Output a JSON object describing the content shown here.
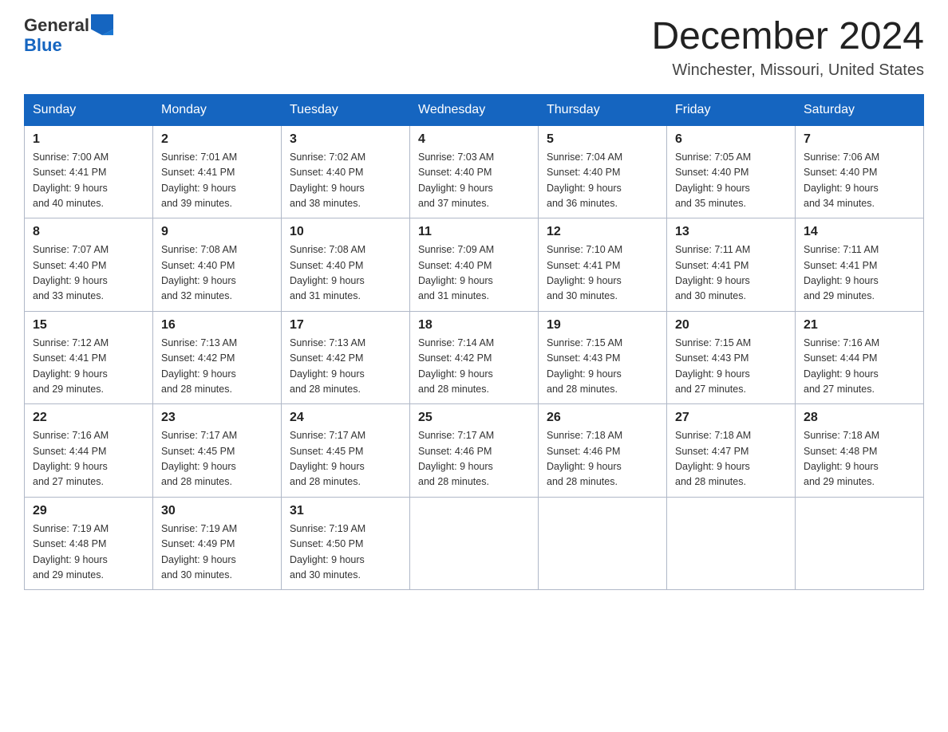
{
  "header": {
    "logo_text_general": "General",
    "logo_text_blue": "Blue",
    "month_year": "December 2024",
    "location": "Winchester, Missouri, United States"
  },
  "weekdays": [
    "Sunday",
    "Monday",
    "Tuesday",
    "Wednesday",
    "Thursday",
    "Friday",
    "Saturday"
  ],
  "weeks": [
    [
      {
        "day": "1",
        "sunrise": "7:00 AM",
        "sunset": "4:41 PM",
        "daylight": "9 hours and 40 minutes."
      },
      {
        "day": "2",
        "sunrise": "7:01 AM",
        "sunset": "4:41 PM",
        "daylight": "9 hours and 39 minutes."
      },
      {
        "day": "3",
        "sunrise": "7:02 AM",
        "sunset": "4:40 PM",
        "daylight": "9 hours and 38 minutes."
      },
      {
        "day": "4",
        "sunrise": "7:03 AM",
        "sunset": "4:40 PM",
        "daylight": "9 hours and 37 minutes."
      },
      {
        "day": "5",
        "sunrise": "7:04 AM",
        "sunset": "4:40 PM",
        "daylight": "9 hours and 36 minutes."
      },
      {
        "day": "6",
        "sunrise": "7:05 AM",
        "sunset": "4:40 PM",
        "daylight": "9 hours and 35 minutes."
      },
      {
        "day": "7",
        "sunrise": "7:06 AM",
        "sunset": "4:40 PM",
        "daylight": "9 hours and 34 minutes."
      }
    ],
    [
      {
        "day": "8",
        "sunrise": "7:07 AM",
        "sunset": "4:40 PM",
        "daylight": "9 hours and 33 minutes."
      },
      {
        "day": "9",
        "sunrise": "7:08 AM",
        "sunset": "4:40 PM",
        "daylight": "9 hours and 32 minutes."
      },
      {
        "day": "10",
        "sunrise": "7:08 AM",
        "sunset": "4:40 PM",
        "daylight": "9 hours and 31 minutes."
      },
      {
        "day": "11",
        "sunrise": "7:09 AM",
        "sunset": "4:40 PM",
        "daylight": "9 hours and 31 minutes."
      },
      {
        "day": "12",
        "sunrise": "7:10 AM",
        "sunset": "4:41 PM",
        "daylight": "9 hours and 30 minutes."
      },
      {
        "day": "13",
        "sunrise": "7:11 AM",
        "sunset": "4:41 PM",
        "daylight": "9 hours and 30 minutes."
      },
      {
        "day": "14",
        "sunrise": "7:11 AM",
        "sunset": "4:41 PM",
        "daylight": "9 hours and 29 minutes."
      }
    ],
    [
      {
        "day": "15",
        "sunrise": "7:12 AM",
        "sunset": "4:41 PM",
        "daylight": "9 hours and 29 minutes."
      },
      {
        "day": "16",
        "sunrise": "7:13 AM",
        "sunset": "4:42 PM",
        "daylight": "9 hours and 28 minutes."
      },
      {
        "day": "17",
        "sunrise": "7:13 AM",
        "sunset": "4:42 PM",
        "daylight": "9 hours and 28 minutes."
      },
      {
        "day": "18",
        "sunrise": "7:14 AM",
        "sunset": "4:42 PM",
        "daylight": "9 hours and 28 minutes."
      },
      {
        "day": "19",
        "sunrise": "7:15 AM",
        "sunset": "4:43 PM",
        "daylight": "9 hours and 28 minutes."
      },
      {
        "day": "20",
        "sunrise": "7:15 AM",
        "sunset": "4:43 PM",
        "daylight": "9 hours and 27 minutes."
      },
      {
        "day": "21",
        "sunrise": "7:16 AM",
        "sunset": "4:44 PM",
        "daylight": "9 hours and 27 minutes."
      }
    ],
    [
      {
        "day": "22",
        "sunrise": "7:16 AM",
        "sunset": "4:44 PM",
        "daylight": "9 hours and 27 minutes."
      },
      {
        "day": "23",
        "sunrise": "7:17 AM",
        "sunset": "4:45 PM",
        "daylight": "9 hours and 28 minutes."
      },
      {
        "day": "24",
        "sunrise": "7:17 AM",
        "sunset": "4:45 PM",
        "daylight": "9 hours and 28 minutes."
      },
      {
        "day": "25",
        "sunrise": "7:17 AM",
        "sunset": "4:46 PM",
        "daylight": "9 hours and 28 minutes."
      },
      {
        "day": "26",
        "sunrise": "7:18 AM",
        "sunset": "4:46 PM",
        "daylight": "9 hours and 28 minutes."
      },
      {
        "day": "27",
        "sunrise": "7:18 AM",
        "sunset": "4:47 PM",
        "daylight": "9 hours and 28 minutes."
      },
      {
        "day": "28",
        "sunrise": "7:18 AM",
        "sunset": "4:48 PM",
        "daylight": "9 hours and 29 minutes."
      }
    ],
    [
      {
        "day": "29",
        "sunrise": "7:19 AM",
        "sunset": "4:48 PM",
        "daylight": "9 hours and 29 minutes."
      },
      {
        "day": "30",
        "sunrise": "7:19 AM",
        "sunset": "4:49 PM",
        "daylight": "9 hours and 30 minutes."
      },
      {
        "day": "31",
        "sunrise": "7:19 AM",
        "sunset": "4:50 PM",
        "daylight": "9 hours and 30 minutes."
      },
      null,
      null,
      null,
      null
    ]
  ]
}
